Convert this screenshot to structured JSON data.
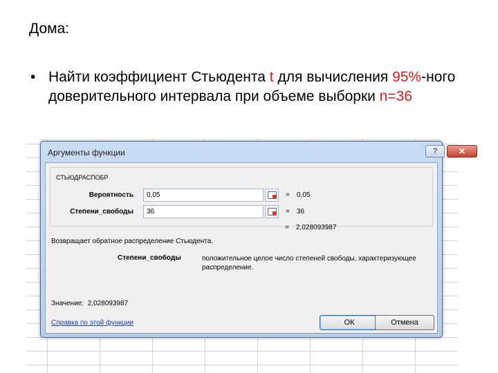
{
  "slide": {
    "heading": "Дома:",
    "bullet": "•",
    "text_1": "Найти коэффициент Стьюдента ",
    "t": "t",
    "text_2": " для вычисления ",
    "pct": "95%",
    "text_3": "-ного доверительного интервала при объеме выборки ",
    "n": "n=36"
  },
  "dialog": {
    "title": "Аргументы функции",
    "help_label": "?",
    "close_label": "✕",
    "function_name": "СТЬЮДРАСПОБР",
    "args": [
      {
        "label": "Вероятность",
        "value": "0,05",
        "result": "0,05"
      },
      {
        "label": "Степени_свободы",
        "value": "36",
        "result": "36"
      }
    ],
    "equals": "=",
    "formula_result": "2,028093987",
    "description": "Возвращает обратное распределение Стьюдента.",
    "param_name": "Степени_свободы",
    "param_description": "положительное целое число степеней свободы, характеризующее распределение.",
    "value_label": "Значение:",
    "value": "2,028093987",
    "help_link": "Справка по этой функции",
    "ok_label": "ОК",
    "cancel_label": "Отмена"
  },
  "colors": {
    "accent_red": "#d41f1f",
    "link_blue": "#1a3fb5"
  }
}
